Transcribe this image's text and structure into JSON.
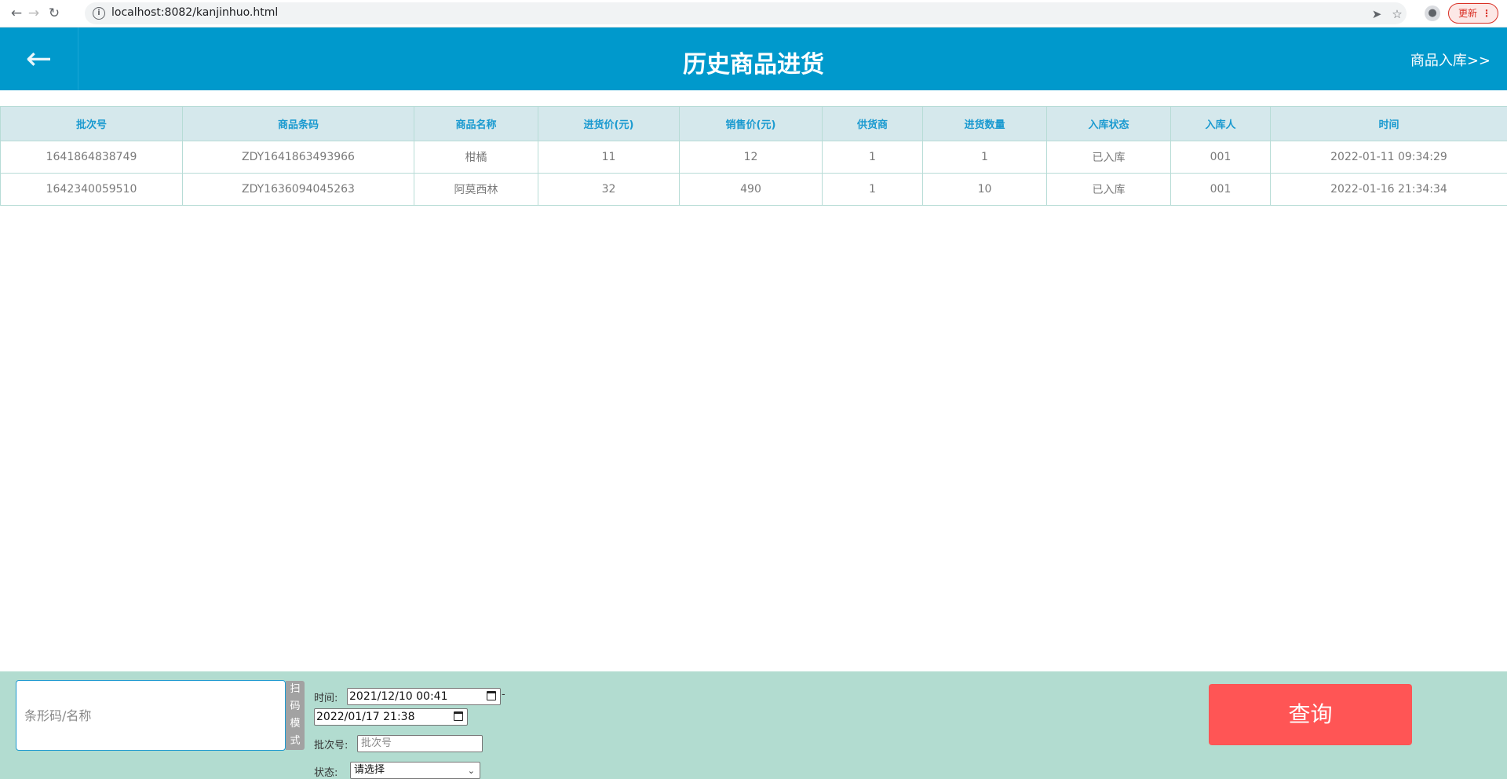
{
  "browser": {
    "url": "localhost:8082/kanjinhuo.html",
    "back_icon": "←",
    "forward_icon": "→",
    "reload_icon": "↻",
    "info_icon": "i",
    "send_icon": "➤",
    "star_icon": "☆",
    "profile_icon": "●",
    "update_label": "更新",
    "menu_icon": "⋮"
  },
  "header": {
    "back_icon": "←",
    "title": "历史商品进货",
    "in_link": "商品入库>>"
  },
  "table": {
    "headers": [
      "批次号",
      "商品条码",
      "商品名称",
      "进货价(元)",
      "销售价(元)",
      "供货商",
      "进货数量",
      "入库状态",
      "入库人",
      "时间"
    ],
    "rows": [
      [
        "1641864838749",
        "ZDY1641863493966",
        "柑橘",
        "11",
        "12",
        "1",
        "1",
        "已入库",
        "001",
        "2022-01-11 09:34:29"
      ],
      [
        "1642340059510",
        "ZDY1636094045263",
        "阿莫西林",
        "32",
        "490",
        "1",
        "10",
        "已入库",
        "001",
        "2022-01-16 21:34:34"
      ]
    ]
  },
  "query": {
    "search_placeholder": "条形码/名称",
    "scan_label": [
      "扫",
      "码",
      "模",
      "式"
    ],
    "time_label": "时间:",
    "start_time": "2021/12/10 00:41",
    "separator": "-",
    "end_time": "2022/01/17 21:38",
    "batch_label": "批次号:",
    "batch_placeholder": "批次号",
    "status_label": "状态:",
    "status_value": "请选择",
    "query_button": "查询"
  },
  "colors": {
    "header_bg": "#0099cc",
    "table_header_bg": "#d5e8ec",
    "panel_bg": "#b2dcd0",
    "query_button": "#ff5555"
  }
}
